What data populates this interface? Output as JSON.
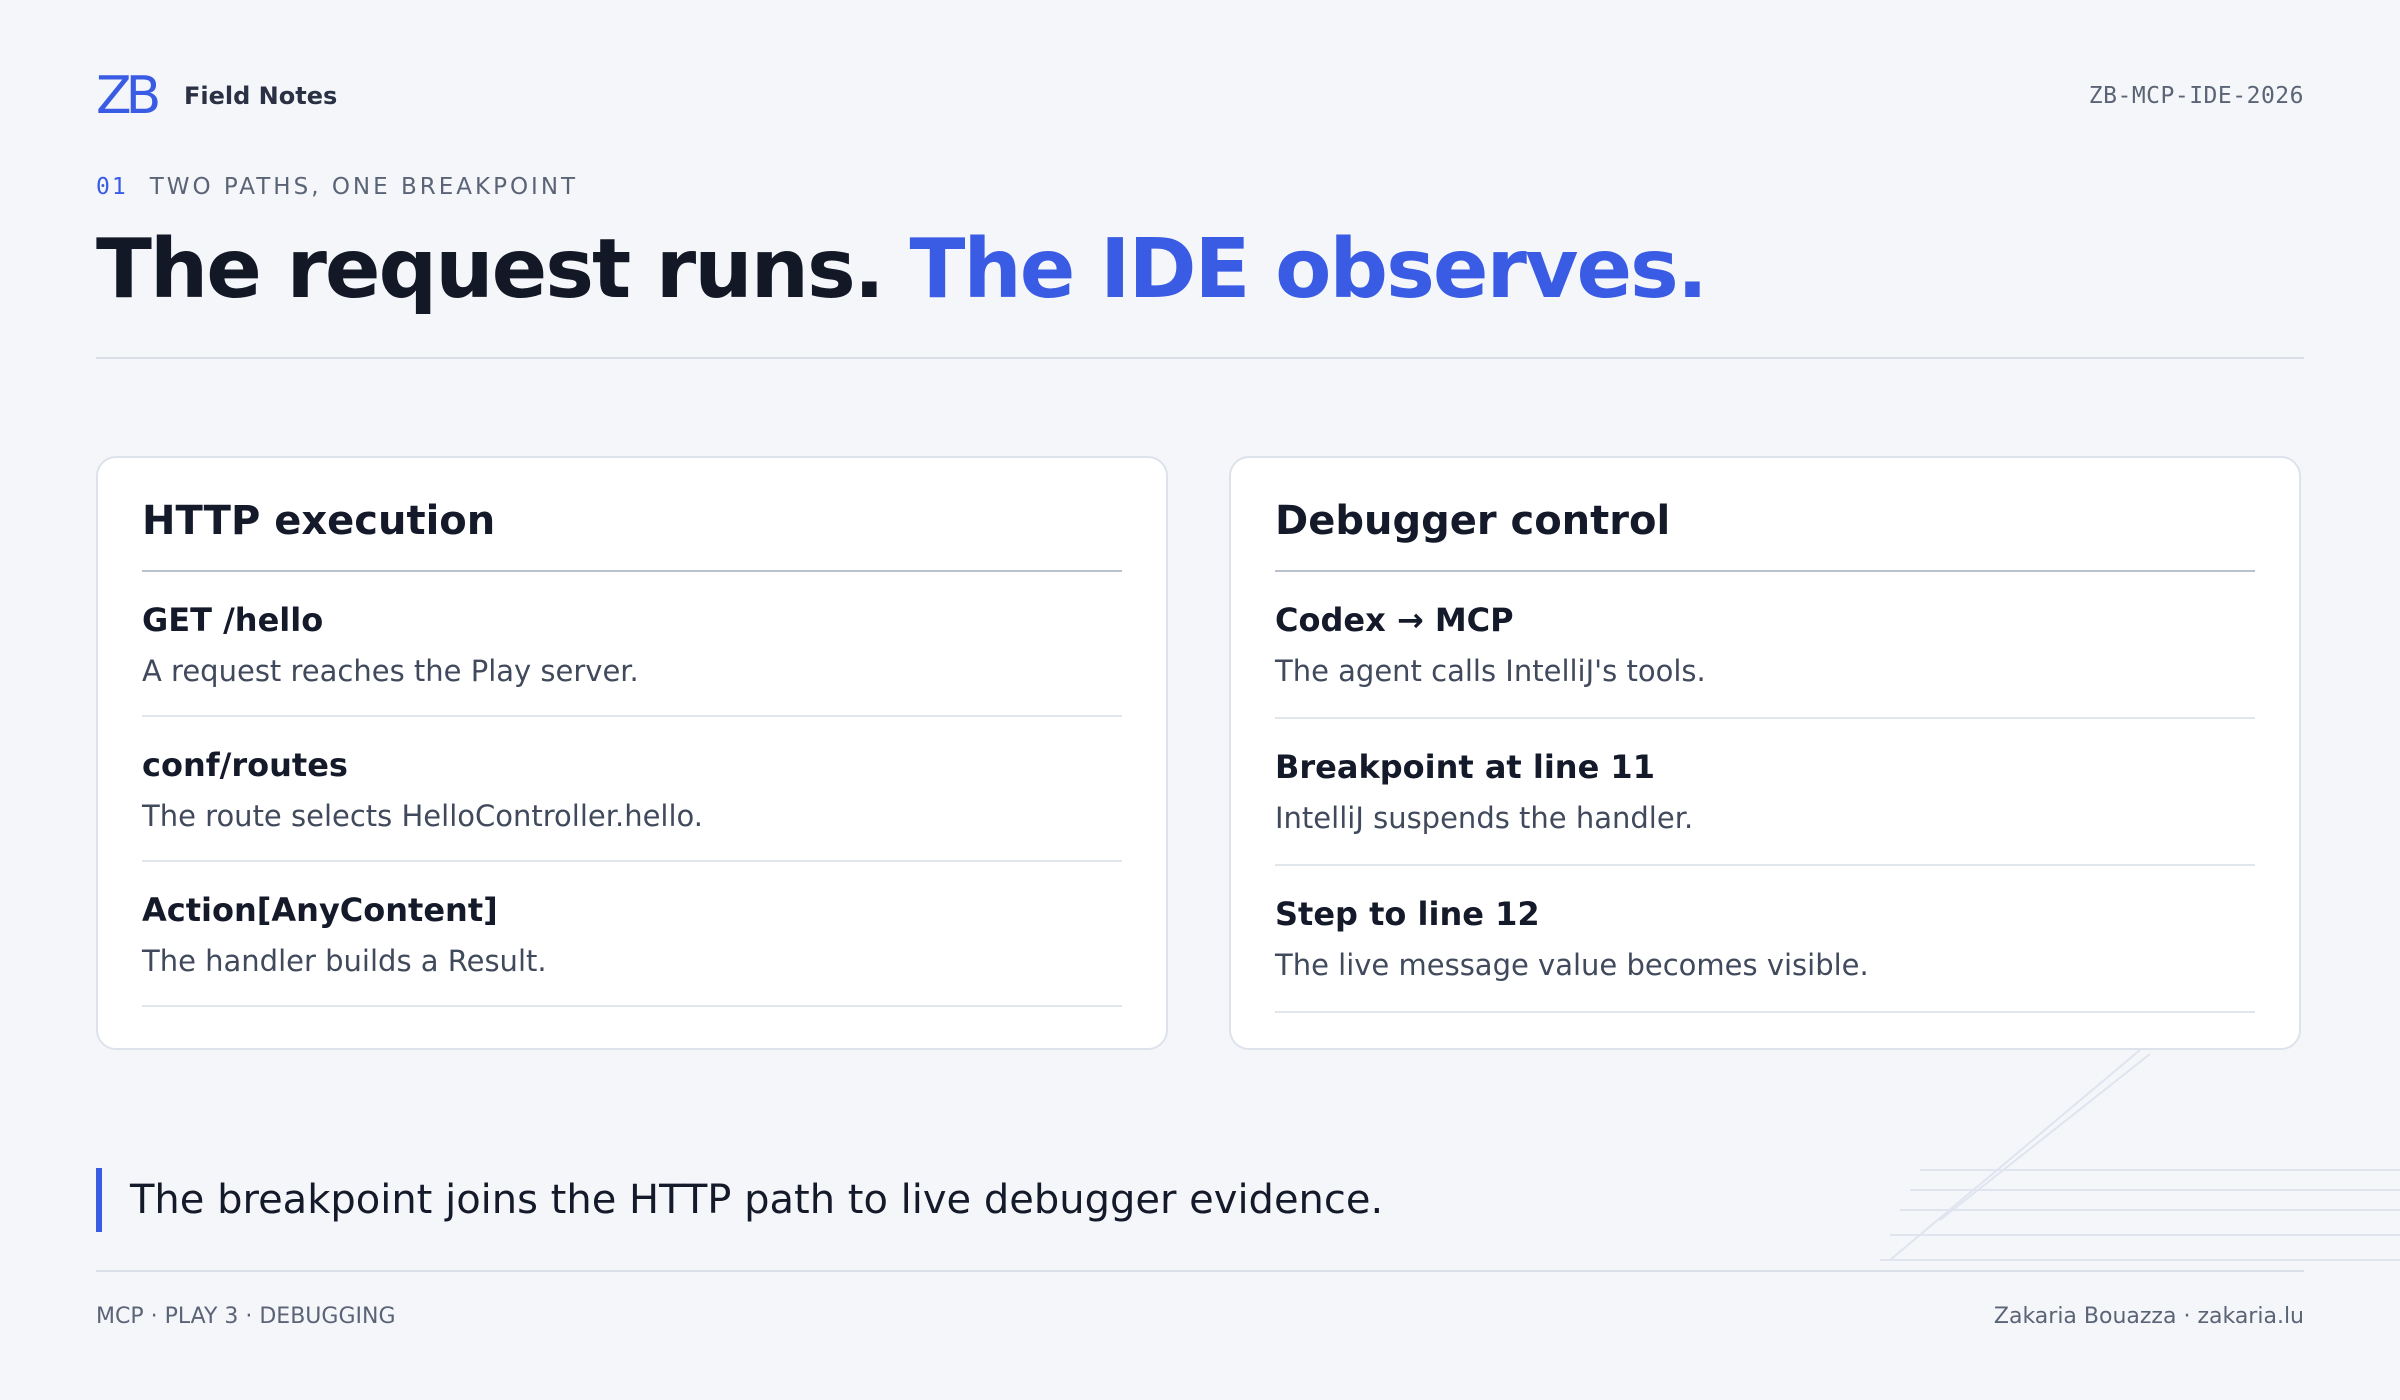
{
  "header": {
    "logo_text": "ZB",
    "brand_name": "Field Notes",
    "doc_code": "ZB-MCP-IDE-2026"
  },
  "eyebrow": {
    "number": "01",
    "label": "TWO PATHS, ONE BREAKPOINT"
  },
  "title": {
    "main": "The request runs.",
    "accent": "The IDE observes."
  },
  "cards": [
    {
      "title": "HTTP execution",
      "items": [
        {
          "head": "GET /hello",
          "desc": "A request reaches the Play server."
        },
        {
          "head": "conf/routes",
          "desc": "The route selects HelloController.hello."
        },
        {
          "head": "Action[AnyContent]",
          "desc": "The handler builds a Result."
        }
      ]
    },
    {
      "title": "Debugger control",
      "items": [
        {
          "head": "Codex → MCP",
          "desc": "The agent calls IntelliJ's tools."
        },
        {
          "head": "Breakpoint at line 11",
          "desc": "IntelliJ suspends the handler."
        },
        {
          "head": "Step to line 12",
          "desc": "The live message value becomes visible."
        }
      ]
    }
  ],
  "quote": "The breakpoint joins the HTTP path to live debugger evidence.",
  "footer": {
    "left": "MCP · PLAY 3 · DEBUGGING",
    "right": "Zakaria Bouazza · zakaria.lu"
  },
  "colors": {
    "accent": "#3a5ce5",
    "background": "#f4f6fa",
    "text": "#141a2a",
    "muted": "#5b6476"
  }
}
